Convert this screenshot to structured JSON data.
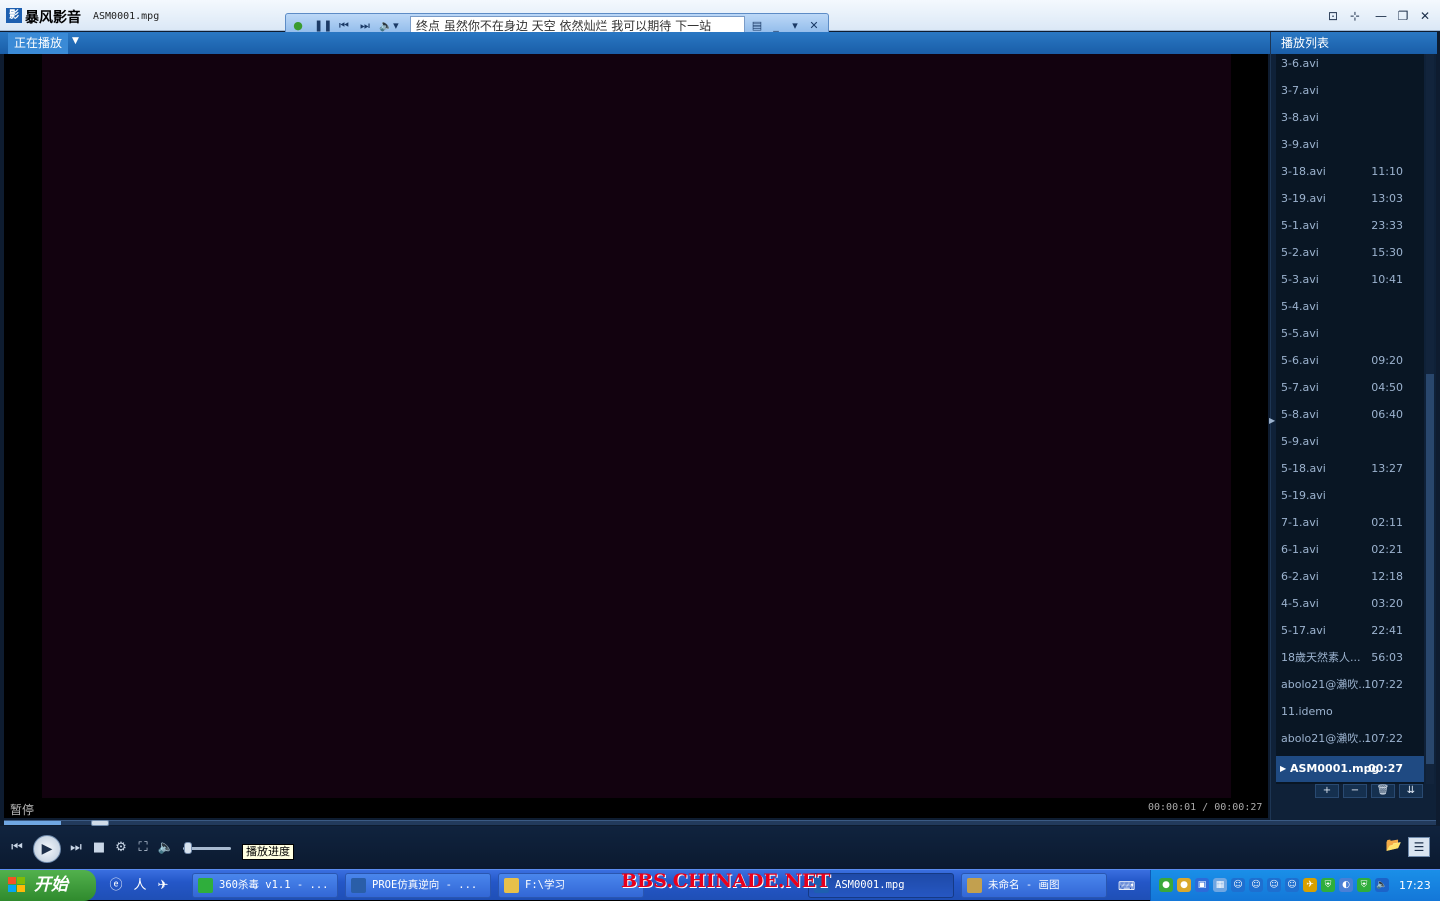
{
  "window": {
    "app_name": "暴风影音",
    "file_title": "ASM0001.mpg",
    "buttons": {
      "pin": "⊡",
      "ontop": "⊹",
      "minimize": "—",
      "restore": "❐",
      "close": "✕"
    }
  },
  "minibar": {
    "lyrics": "终点  虽然你不在身边  天空  依然灿烂  我可以期待  下一站"
  },
  "tabs": {
    "now_playing": "正在播放"
  },
  "status": {
    "state": "暂停",
    "time": "00:00:01 / 00:00:27"
  },
  "seek": {
    "progress": 0.04
  },
  "volume": {
    "level": 0.05
  },
  "tooltip": {
    "text": "播放进度"
  },
  "playlist": {
    "header": "播放列表",
    "items": [
      {
        "name": "3-6.avi",
        "duration": ""
      },
      {
        "name": "3-7.avi",
        "duration": ""
      },
      {
        "name": "3-8.avi",
        "duration": ""
      },
      {
        "name": "3-9.avi",
        "duration": ""
      },
      {
        "name": "3-18.avi",
        "duration": "11:10"
      },
      {
        "name": "3-19.avi",
        "duration": "13:03"
      },
      {
        "name": "5-1.avi",
        "duration": "23:33"
      },
      {
        "name": "5-2.avi",
        "duration": "15:30"
      },
      {
        "name": "5-3.avi",
        "duration": "10:41"
      },
      {
        "name": "5-4.avi",
        "duration": ""
      },
      {
        "name": "5-5.avi",
        "duration": ""
      },
      {
        "name": "5-6.avi",
        "duration": "09:20"
      },
      {
        "name": "5-7.avi",
        "duration": "04:50"
      },
      {
        "name": "5-8.avi",
        "duration": "06:40"
      },
      {
        "name": "5-9.avi",
        "duration": ""
      },
      {
        "name": "5-18.avi",
        "duration": "13:27"
      },
      {
        "name": "5-19.avi",
        "duration": ""
      },
      {
        "name": "7-1.avi",
        "duration": "02:11"
      },
      {
        "name": "6-1.avi",
        "duration": "02:21"
      },
      {
        "name": "6-2.avi",
        "duration": "12:18"
      },
      {
        "name": "4-5.avi",
        "duration": "03:20"
      },
      {
        "name": "5-17.avi",
        "duration": "22:41"
      },
      {
        "name": "18歲天然素人...",
        "duration": "56:03"
      },
      {
        "name": "abolo21@瀨吹...",
        "duration": "107:22"
      },
      {
        "name": "11.idemo",
        "duration": ""
      },
      {
        "name": "abolo21@瀨吹...",
        "duration": "107:22"
      }
    ],
    "active": {
      "name": "ASM0001.mpg",
      "duration": "00:27"
    },
    "tools": {
      "add": "+",
      "remove": "−",
      "delete": "🗑",
      "sort": "⇊"
    }
  },
  "taskbar": {
    "start_label": "开始",
    "tasks": [
      {
        "label": "360杀毒 v1.1 - ...",
        "icon_color": "#2fae3c"
      },
      {
        "label": "PROE仿真逆向 - ...",
        "icon_color": "#2a5ea8"
      },
      {
        "label": "F:\\学习",
        "icon_color": "#e7c04a"
      },
      {
        "label": "ASM0001.mpg",
        "icon_color": "#1d5fb0"
      },
      {
        "label": "未命名 - 画图",
        "icon_color": "#c2a04f"
      }
    ],
    "watermark": "BBS.CHINADE.NET",
    "clock": "17:23"
  }
}
